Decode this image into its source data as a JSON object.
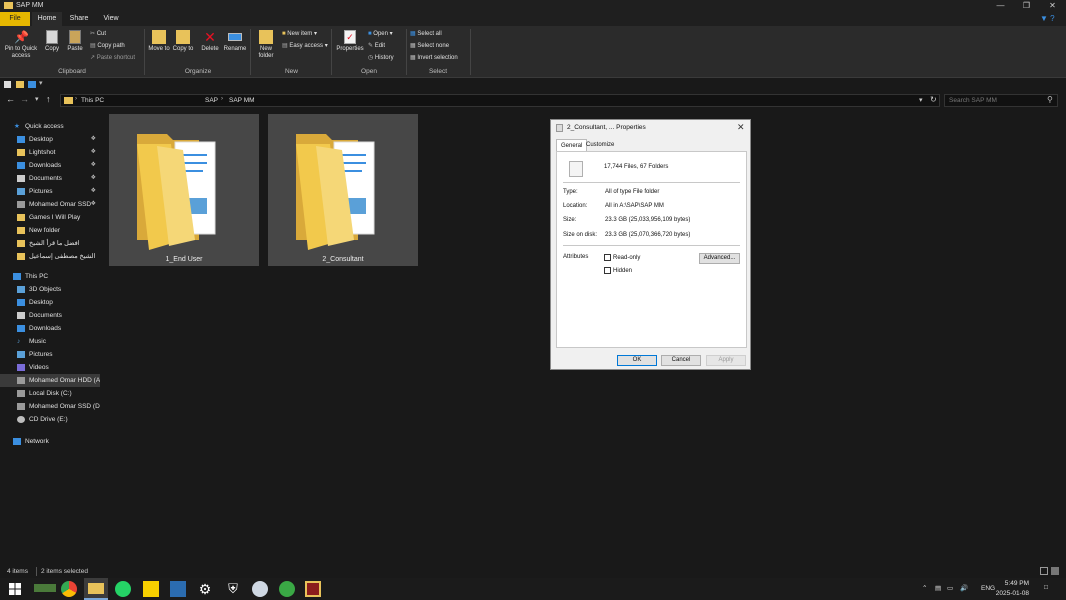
{
  "window": {
    "title": "SAP MM"
  },
  "tabs": [
    "File",
    "Home",
    "Share",
    "View"
  ],
  "ribbon": {
    "clipboard": {
      "pin_label": "Pin to Quick access",
      "copy": "Copy",
      "paste": "Paste",
      "cut": "Cut",
      "copy_path": "Copy path",
      "paste_shortcut": "Paste shortcut",
      "group": "Clipboard"
    },
    "organize": {
      "move_to": "Move to",
      "copy_to": "Copy to",
      "delete": "Delete",
      "rename": "Rename",
      "group": "Organize"
    },
    "new": {
      "new_folder": "New folder",
      "new_item": "New item",
      "easy_access": "Easy access",
      "group": "New"
    },
    "open": {
      "properties": "Properties",
      "open": "Open",
      "edit": "Edit",
      "history": "History",
      "group": "Open"
    },
    "select": {
      "select_all": "Select all",
      "select_none": "Select none",
      "invert": "Invert selection",
      "group": "Select"
    }
  },
  "address": {
    "this_pc": "This PC",
    "path1": "SAP",
    "path2": "SAP MM",
    "search_placeholder": "Search SAP MM"
  },
  "nav": {
    "quick_access": "Quick access",
    "quick_items": [
      "Desktop",
      "Lightshot",
      "Downloads",
      "Documents",
      "Pictures",
      "Mohamed Omar SSD",
      "Games I Will Play",
      "New folder",
      "افضل ما قرأ الشيخ",
      "الشيخ مصطفى إسماعيل"
    ],
    "this_pc": "This PC",
    "pc_items": [
      "3D Objects",
      "Desktop",
      "Documents",
      "Downloads",
      "Music",
      "Pictures",
      "Videos",
      "Mohamed Omar HDD (A:)",
      "Local Disk (C:)",
      "Mohamed Omar SSD (D:)",
      "CD Drive (E:)"
    ],
    "network": "Network"
  },
  "folders": [
    "1_End User",
    "2_Consultant"
  ],
  "dialog": {
    "title": "2_Consultant, ... Properties",
    "tab_general": "General",
    "tab_customize": "Customize",
    "summary": "17,744 Files, 67 Folders",
    "type_label": "Type:",
    "type_value": "All of type File folder",
    "location_label": "Location:",
    "location_value": "All in A:\\SAP\\SAP MM",
    "size_label": "Size:",
    "size_value": "23.3 GB (25,033,956,109 bytes)",
    "sod_label": "Size on disk:",
    "sod_value": "23.3 GB (25,070,366,720 bytes)",
    "attributes_label": "Attributes",
    "readonly": "Read-only",
    "hidden": "Hidden",
    "advanced": "Advanced...",
    "ok": "OK",
    "cancel": "Cancel",
    "apply": "Apply"
  },
  "status": {
    "items": "4 items",
    "selected": "2 items selected"
  },
  "tray": {
    "lang": "ENG",
    "time": "5:49 PM",
    "date": "2025-01-08"
  },
  "colors": {
    "folder": "#f2c94c",
    "accent": "#0078d7",
    "file_tab": "#e6b700"
  }
}
